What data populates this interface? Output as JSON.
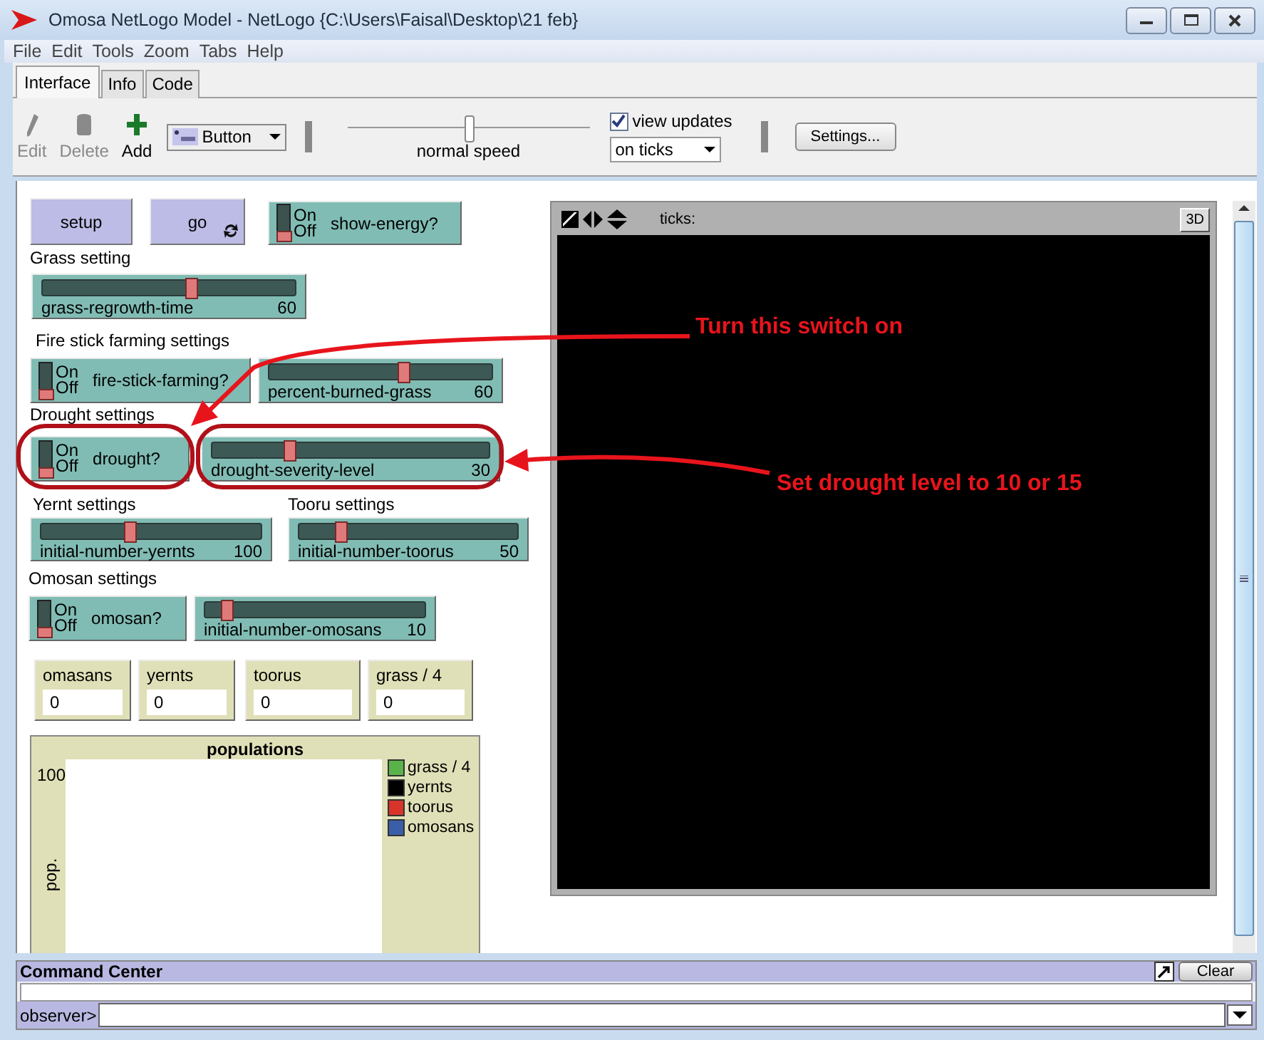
{
  "window": {
    "title": "Omosa NetLogo Model - NetLogo {C:\\Users\\Faisal\\Desktop\\21 feb}"
  },
  "menu": [
    "File",
    "Edit",
    "Tools",
    "Zoom",
    "Tabs",
    "Help"
  ],
  "tabs": [
    {
      "label": "Interface",
      "selected": true
    },
    {
      "label": "Info",
      "selected": false
    },
    {
      "label": "Code",
      "selected": false
    }
  ],
  "toolbar": {
    "tools": [
      {
        "label": "Edit",
        "disabled": true
      },
      {
        "label": "Delete",
        "disabled": true
      },
      {
        "label": "Add",
        "disabled": false
      }
    ],
    "widget_type": "Button",
    "speed": {
      "level": 0.5,
      "label": "normal speed"
    },
    "view_updates": {
      "label": "view updates",
      "checked": true
    },
    "update_mode": "on ticks",
    "settings_button": "Settings..."
  },
  "widgets": [
    {
      "kind": "button",
      "label": "setup",
      "forever": false
    },
    {
      "kind": "button",
      "label": "go",
      "forever": true
    },
    {
      "kind": "switch",
      "label": "show-energy?",
      "on_label": "On",
      "off_label": "Off",
      "on": false
    },
    {
      "kind": "label",
      "text": "Grass setting"
    },
    {
      "kind": "slider",
      "label": "grass-regrowth-time",
      "value": "60",
      "level": 0.59
    },
    {
      "kind": "label",
      "text": "Fire stick farming settings"
    },
    {
      "kind": "switch",
      "label": "fire-stick-farming?",
      "on_label": "On",
      "off_label": "Off",
      "on": false
    },
    {
      "kind": "slider",
      "label": "percent-burned-grass",
      "value": "60",
      "level": 0.6
    },
    {
      "kind": "label",
      "text": "Drought settings"
    },
    {
      "kind": "switch",
      "label": "drought?",
      "on_label": "On",
      "off_label": "Off",
      "on": false
    },
    {
      "kind": "slider",
      "label": "drought-severity-level",
      "value": "30",
      "level": 0.28
    },
    {
      "kind": "label",
      "text": "Yernt settings"
    },
    {
      "kind": "label",
      "text": "Tooru settings"
    },
    {
      "kind": "slider",
      "label": "initial-number-yernts",
      "value": "100",
      "level": 0.4
    },
    {
      "kind": "slider",
      "label": "initial-number-toorus",
      "value": "50",
      "level": 0.19
    },
    {
      "kind": "label",
      "text": "Omosan settings"
    },
    {
      "kind": "switch",
      "label": "omosan?",
      "on_label": "On",
      "off_label": "Off",
      "on": false
    },
    {
      "kind": "slider",
      "label": "initial-number-omosans",
      "value": "10",
      "level": 0.1
    },
    {
      "kind": "monitor",
      "label": "omasans",
      "value": "0"
    },
    {
      "kind": "monitor",
      "label": "yernts",
      "value": "0"
    },
    {
      "kind": "monitor",
      "label": "toorus",
      "value": "0"
    },
    {
      "kind": "monitor",
      "label": "grass / 4",
      "value": "0"
    }
  ],
  "view": {
    "ticks_label": "ticks:",
    "button_3d": "3D"
  },
  "plot": {
    "title": "populations",
    "y_max": "100",
    "ylabel": "pop.",
    "legend": [
      {
        "name": "grass / 4",
        "color": "#5ab34a"
      },
      {
        "name": "yernts",
        "color": "#000000"
      },
      {
        "name": "toorus",
        "color": "#d8342a"
      },
      {
        "name": "omosans",
        "color": "#3a5ea8"
      }
    ]
  },
  "command_center": {
    "title": "Command Center",
    "clear_button": "Clear",
    "prompt": "observer>"
  },
  "annotations": [
    {
      "text": "Turn this switch on"
    },
    {
      "text": "Set drought level to 10 or 15"
    }
  ]
}
